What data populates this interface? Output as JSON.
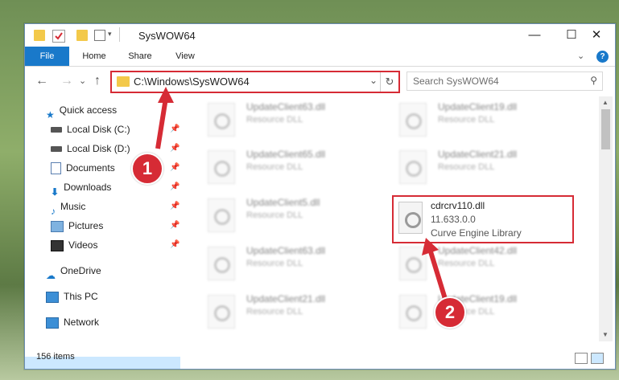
{
  "window": {
    "title": "SysWOW64"
  },
  "ribbon": {
    "tabs": [
      "File",
      "Home",
      "Share",
      "View"
    ],
    "chevron": "⌄",
    "help": "?"
  },
  "window_controls": {
    "minimize": "—",
    "maximize": "☐",
    "close": "✕"
  },
  "nav": {
    "back": "←",
    "forward": "→",
    "recent": "⌄",
    "up": "↑"
  },
  "address": {
    "path": "C:\\Windows\\SysWOW64",
    "dropdown": "⌄",
    "refresh": "↻"
  },
  "search": {
    "placeholder": "Search SysWOW64",
    "icon": "⚲"
  },
  "sidebar": {
    "items": [
      {
        "label": "Quick access",
        "icon": "star-icon",
        "pinned": false
      },
      {
        "label": "Local Disk (C:)",
        "icon": "drive-icon",
        "pinned": true
      },
      {
        "label": "Local Disk (D:)",
        "icon": "drive-icon",
        "pinned": true
      },
      {
        "label": "Documents",
        "icon": "documents-icon",
        "pinned": true
      },
      {
        "label": "Downloads",
        "icon": "download-icon",
        "pinned": true
      },
      {
        "label": "Music",
        "icon": "music-icon",
        "pinned": true
      },
      {
        "label": "Pictures",
        "icon": "pictures-icon",
        "pinned": true
      },
      {
        "label": "Videos",
        "icon": "videos-icon",
        "pinned": true
      },
      {
        "label": "OneDrive",
        "icon": "cloud-icon",
        "pinned": false
      },
      {
        "label": "This PC",
        "icon": "computer-icon",
        "pinned": false,
        "selected": true
      },
      {
        "label": "Network",
        "icon": "network-icon",
        "pinned": false
      }
    ],
    "pin_glyph": "📌"
  },
  "files": [
    {
      "name": "UpdateClient63.dll",
      "type": "Resource DLL"
    },
    {
      "name": "UpdateClient19.dll",
      "type": "Resource DLL"
    },
    {
      "name": "UpdateClient65.dll",
      "type": "Resource DLL"
    },
    {
      "name": "UpdateClient21.dll",
      "type": "Resource DLL"
    },
    {
      "name": "UpdateClient5.dll",
      "type": "Resource DLL"
    },
    {
      "name": "UpdateClient63.dll",
      "type": "Resource DLL"
    },
    {
      "name": "UpdateClient42.dll",
      "type": "Resource DLL"
    },
    {
      "name": "UpdateClient21.dll",
      "type": "Resource DLL"
    },
    {
      "name": "UpdateClient19.dll",
      "type": "Resource DLL"
    }
  ],
  "focused_file": {
    "name": "cdrcrv110.dll",
    "version": "11.633.0.0",
    "description": "Curve Engine Library"
  },
  "status": {
    "items": "156 items"
  },
  "annotations": {
    "step1": "1",
    "step2": "2"
  },
  "colors": {
    "accent": "#1979ca",
    "highlight": "#d62b35",
    "selection": "#cce8ff"
  }
}
